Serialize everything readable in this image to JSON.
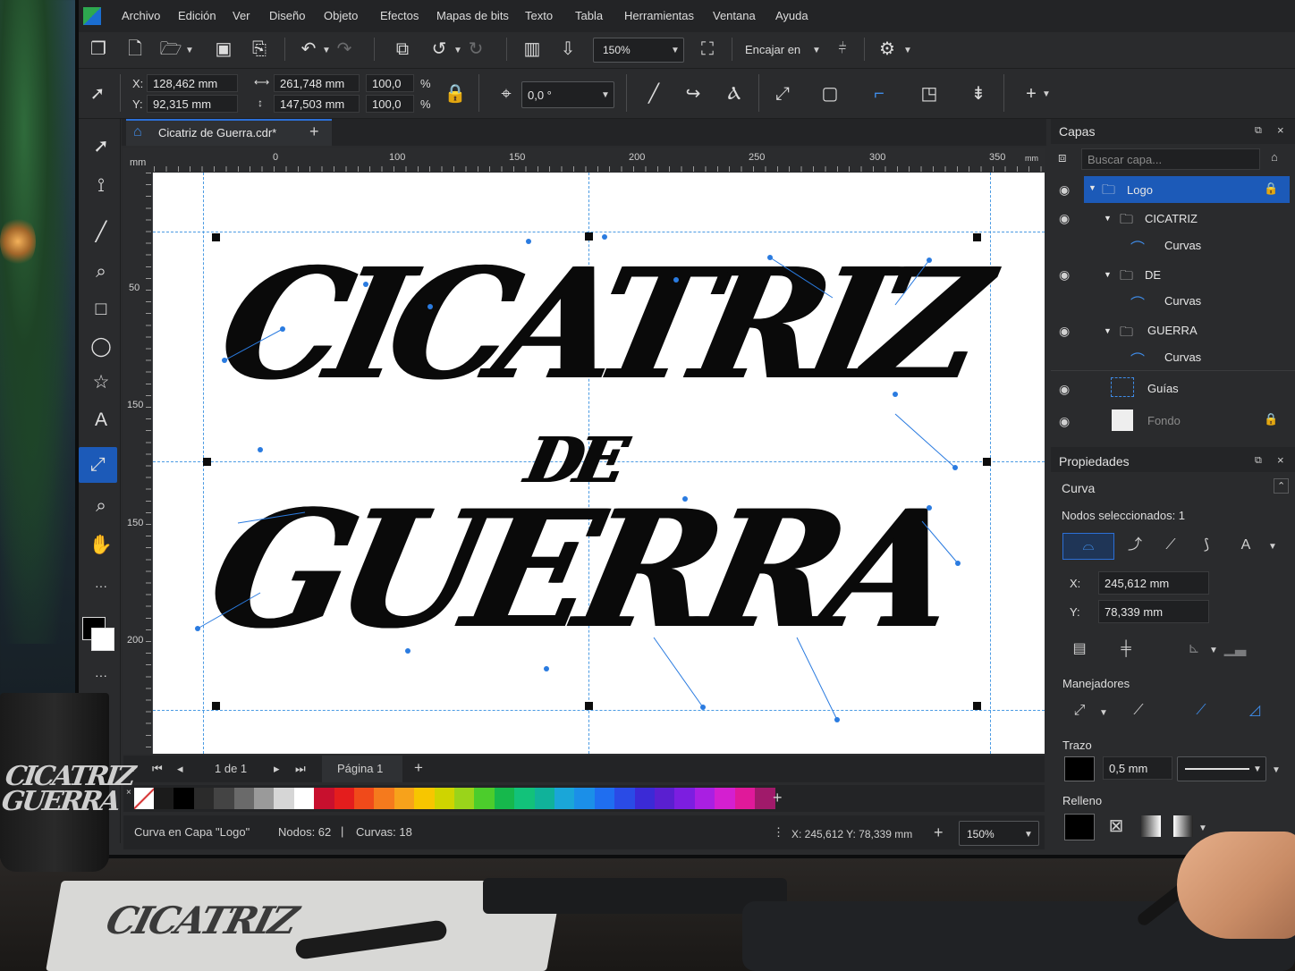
{
  "menu": [
    "Archivo",
    "Edición",
    "Ver",
    "Diseño",
    "Objeto",
    "Efectos",
    "Mapas de bits",
    "Texto",
    "Tabla",
    "Herramientas",
    "Ventana",
    "Ayuda"
  ],
  "toolbar": {
    "zoom": "150%",
    "snap_label": "Encajar en"
  },
  "property_bar": {
    "x_label": "X:",
    "x_value": "128,462 mm",
    "y_label": "Y:",
    "y_value": "92,315 mm",
    "width_value": "261,748 mm",
    "height_value": "147,503 mm",
    "scale_w": "100,0",
    "scale_h": "100,0",
    "percent": "%",
    "angle": "0,0 °"
  },
  "document": {
    "tab_title": "Cicatriz de Guerra.cdr*",
    "add_tab": "+"
  },
  "ruler": {
    "unit": "mm",
    "h_ticks": [
      "0",
      "100",
      "150",
      "200",
      "250",
      "300",
      "350"
    ],
    "v_ticks": [
      "50",
      "150",
      "150",
      "200"
    ]
  },
  "artwork": {
    "line1": "CICATRIZ",
    "line2": "DE",
    "line3": "GUERRA"
  },
  "page_nav": {
    "page_count": "1 de 1",
    "page_tab": "Página 1",
    "add": "+"
  },
  "palette": [
    "#1b1b1b",
    "#000000",
    "#2b2b2b",
    "#444444",
    "#6a6a6a",
    "#9a9a9a",
    "#d6d6d6",
    "#ffffff",
    "#c8102e",
    "#e41d1d",
    "#f04a1a",
    "#f57a1d",
    "#f7a21b",
    "#f7c600",
    "#cfd400",
    "#9ad41a",
    "#4ccd2c",
    "#16b84c",
    "#12c27a",
    "#10b29a",
    "#1aa6d8",
    "#1b8fe8",
    "#1f6ef0",
    "#2a4be6",
    "#3b2ad6",
    "#5a1fd0",
    "#7c1ee0",
    "#a91fe2",
    "#d41fd0",
    "#e0199a",
    "#a01a6a"
  ],
  "status": {
    "object": "Curva en Capa \"Logo\"",
    "nodes": "Nodos: 62",
    "sep": "|",
    "curves": "Curvas: 18",
    "coords": "X: 245,612  Y: 78,339 mm",
    "zoom": "150%"
  },
  "layers_panel": {
    "title": "Capas",
    "search_placeholder": "Buscar capa...",
    "rows": [
      {
        "name": "Logo"
      },
      {
        "name": "CICATRIZ"
      },
      {
        "name": "Curvas"
      },
      {
        "name": "DE"
      },
      {
        "name": "Curvas"
      },
      {
        "name": "GUERRA"
      },
      {
        "name": "Curvas"
      },
      {
        "name": "Guías"
      },
      {
        "name": "Fondo"
      }
    ]
  },
  "properties_panel": {
    "title": "Propiedades",
    "section": "Curva",
    "selected_nodes": "Nodos seleccionados: 1",
    "x_label": "X:",
    "x_value": "245,612 mm",
    "y_label": "Y:",
    "y_value": "78,339 mm",
    "handles_label": "Manejadores",
    "stroke_label": "Trazo",
    "stroke_width": "0,5 mm",
    "fill_label": "Relleno"
  },
  "colors": {
    "accent": "#1c5ab8",
    "selection": "#2c6fd6"
  }
}
